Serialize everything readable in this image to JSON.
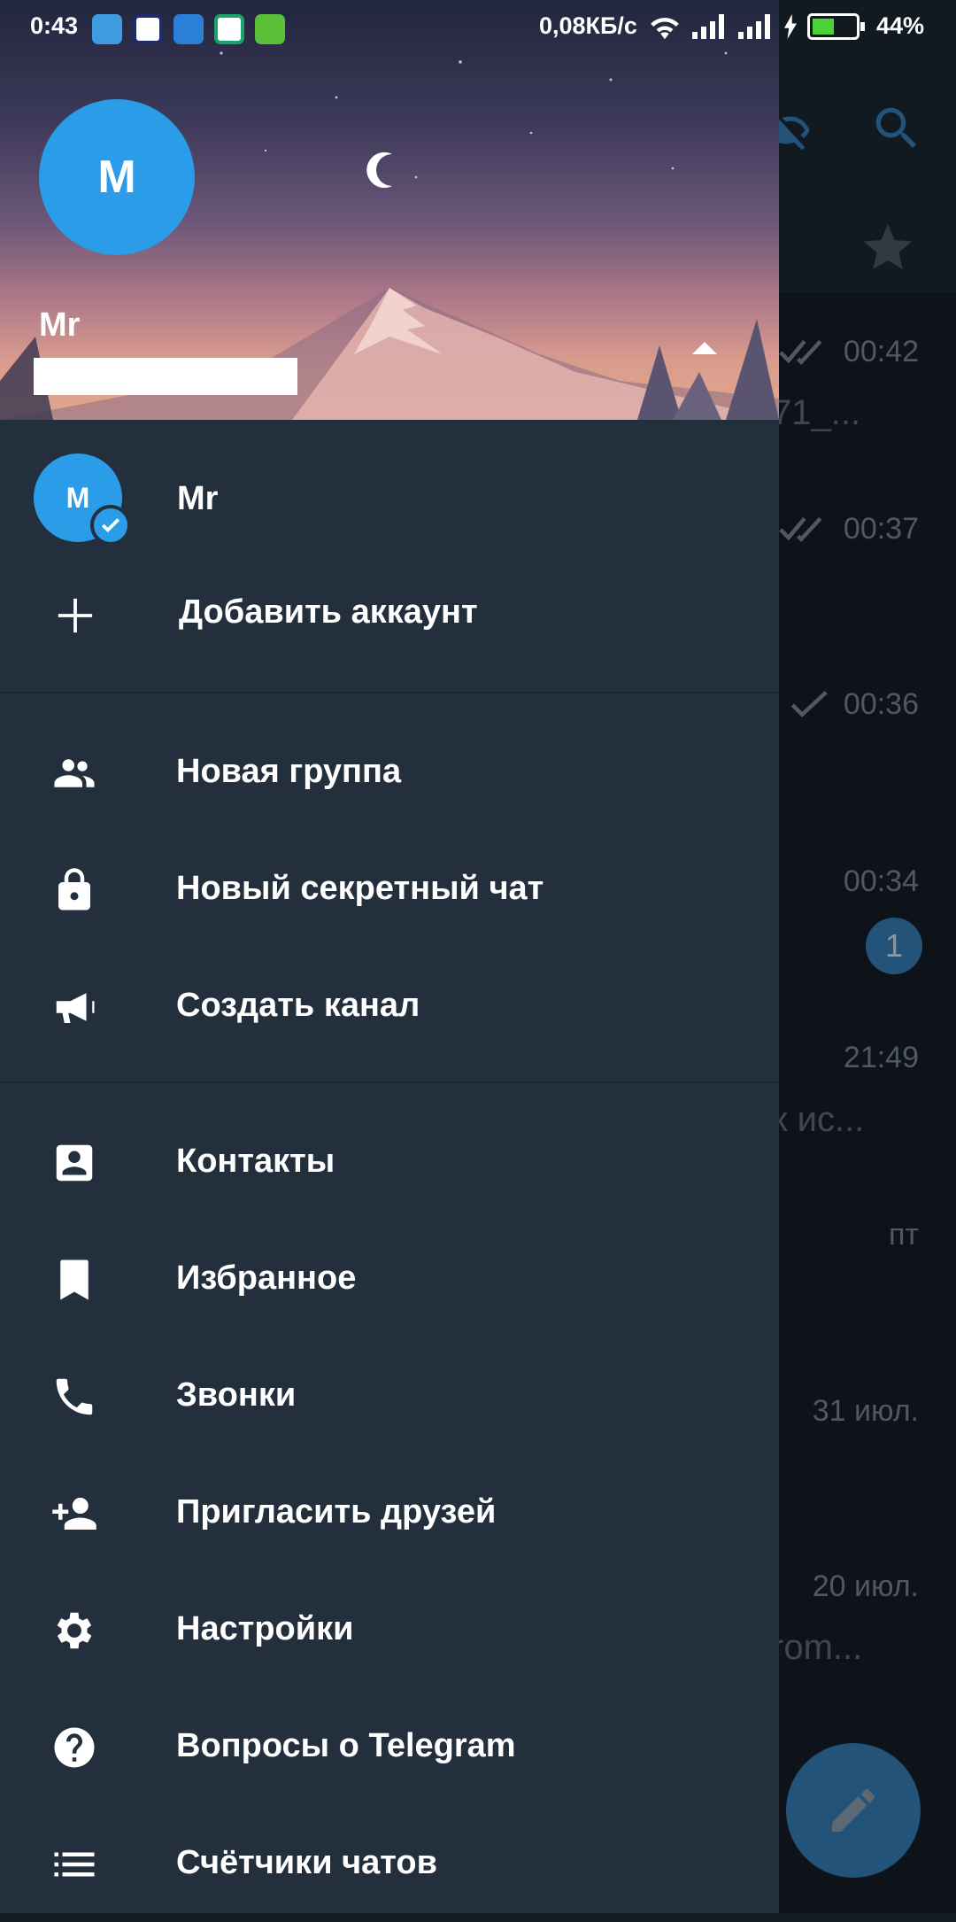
{
  "status_bar": {
    "time": "0:43",
    "network_speed": "0,08КБ/с",
    "battery": "44%"
  },
  "drawer": {
    "header": {
      "avatar_initial": "M",
      "name": "Mr",
      "phone": "",
      "accent_color": "#2a9ce8"
    },
    "account": {
      "avatar_initial": "M",
      "name": "Mr"
    },
    "add_account": "Добавить аккаунт",
    "menu": [
      {
        "label": "Новая группа",
        "icon": "group-icon"
      },
      {
        "label": "Новый секретный чат",
        "icon": "lock-icon"
      },
      {
        "label": "Создать канал",
        "icon": "megaphone-icon"
      },
      {
        "label": "Контакты",
        "icon": "contact-icon"
      },
      {
        "label": "Избранное",
        "icon": "bookmark-icon"
      },
      {
        "label": "Звонки",
        "icon": "phone-icon"
      },
      {
        "label": "Пригласить друзей",
        "icon": "add-person-icon"
      },
      {
        "label": "Настройки",
        "icon": "gear-icon"
      },
      {
        "label": "Вопросы о Telegram",
        "icon": "help-icon"
      },
      {
        "label": "Счётчики чатов",
        "icon": "list-icon"
      }
    ]
  },
  "background_chats": {
    "times": [
      "00:42",
      "00:37",
      "00:36",
      "00:34",
      "21:49",
      "пт",
      "31 июл.",
      "20 июл."
    ],
    "snippets": [
      "71_...",
      "к ис...",
      "rom..."
    ],
    "unread_badge": "1"
  }
}
